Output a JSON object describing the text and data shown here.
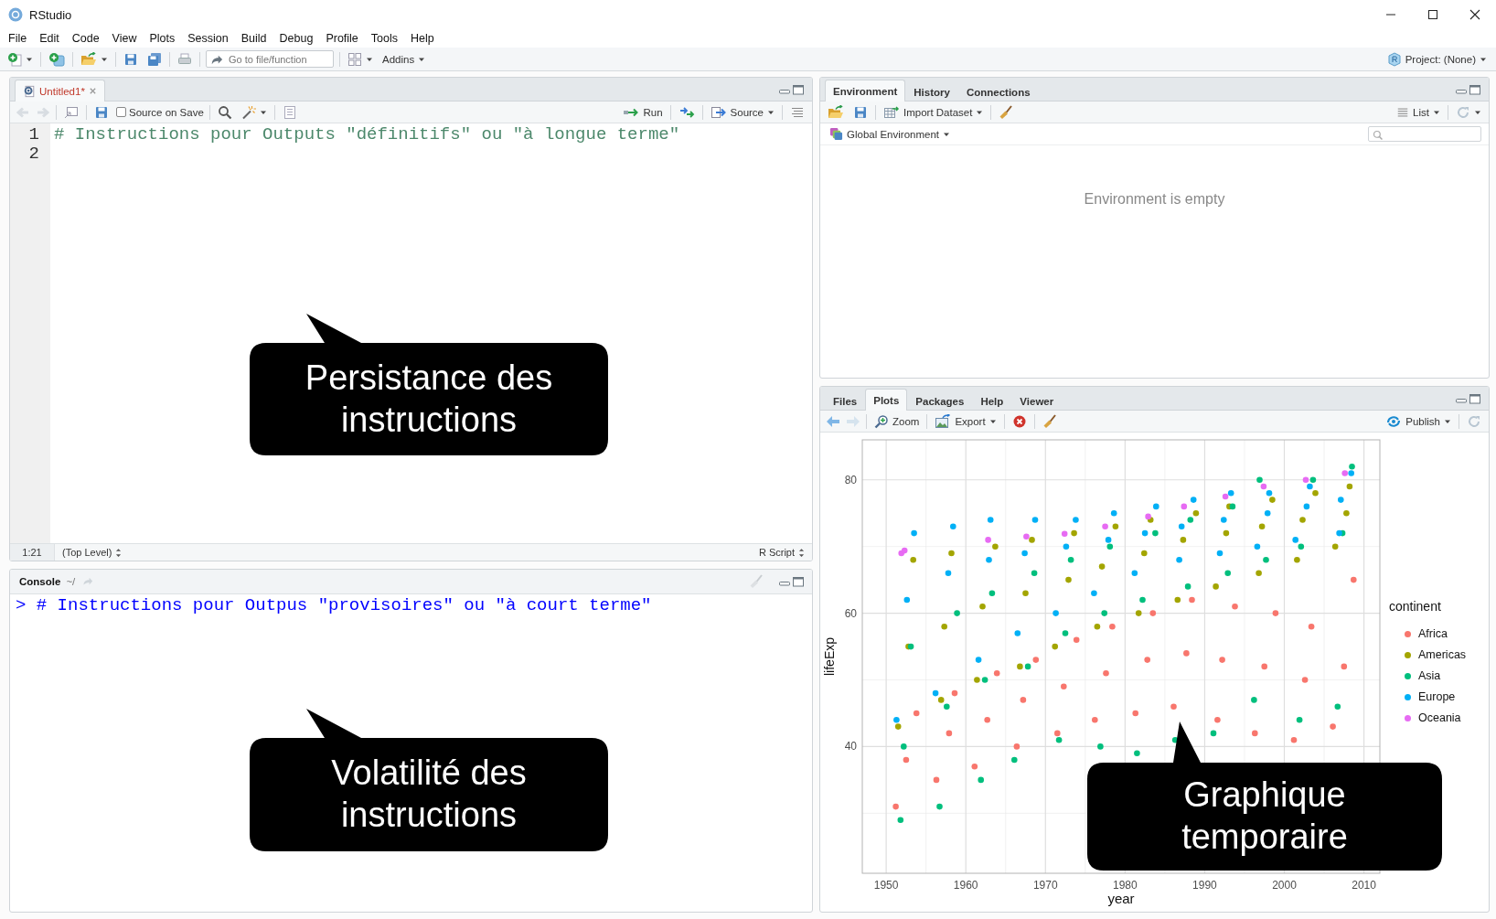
{
  "window": {
    "title": "RStudio"
  },
  "menu": [
    "File",
    "Edit",
    "Code",
    "View",
    "Plots",
    "Session",
    "Build",
    "Debug",
    "Profile",
    "Tools",
    "Help"
  ],
  "toolbar": {
    "goto_placeholder": "Go to file/function",
    "addins": "Addins",
    "project": "Project: (None)"
  },
  "editor": {
    "tabs": [
      {
        "label": "Untitled1*",
        "selected": true,
        "unsaved": true
      }
    ],
    "source_on_save": {
      "label": "Source on Save",
      "checked": false
    },
    "run": "Run",
    "source": "Source",
    "lines": [
      {
        "number": "1",
        "code": "# Instructions pour Outputs \"définitifs\" ou \"à longue terme\""
      },
      {
        "number": "2"
      }
    ],
    "status": {
      "position": "1:21",
      "scope": "(Top Level)",
      "file_type": "R Script"
    }
  },
  "console": {
    "title": "Console",
    "path": "~/",
    "prompt": ">",
    "command": "# Instructions pour Outpus \"provisoires\" ou \"à court terme\""
  },
  "environment_pane": {
    "tabs": [
      {
        "label": "Environment",
        "selected": true
      },
      {
        "label": "History",
        "selected": false
      },
      {
        "label": "Connections",
        "selected": false
      }
    ],
    "import_dataset": "Import Dataset",
    "view_mode": "List",
    "scope": "Global Environment",
    "empty_message": "Environment is empty"
  },
  "plots_pane": {
    "tabs": [
      {
        "label": "Files",
        "selected": false
      },
      {
        "label": "Plots",
        "selected": true
      },
      {
        "label": "Packages",
        "selected": false
      },
      {
        "label": "Help",
        "selected": false
      },
      {
        "label": "Viewer",
        "selected": false
      }
    ],
    "zoom": "Zoom",
    "export": "Export",
    "publish": "Publish",
    "legend_title": "continent",
    "chart_data": {
      "type": "scatter",
      "xlabel": "year",
      "ylabel": "lifeExp",
      "xlim": [
        1947,
        2012
      ],
      "ylim": [
        21,
        86
      ],
      "grid": true,
      "legend": "right",
      "xticks": [
        1950,
        1960,
        1970,
        1980,
        1990,
        2000,
        2010
      ],
      "yticks": [
        40,
        60,
        80
      ],
      "series": [
        {
          "name": "Africa",
          "color": "#f8766d",
          "x": [
            1951.2,
            1952.5,
            1953.8,
            1956.3,
            1957.9,
            1958.6,
            1961.1,
            1962.7,
            1963.9,
            1966.4,
            1967.2,
            1968.8,
            1971.5,
            1972.3,
            1973.9,
            1976.2,
            1977.6,
            1978.4,
            1981.3,
            1982.8,
            1983.5,
            1986.1,
            1987.7,
            1988.4,
            1991.6,
            1992.2,
            1993.8,
            1996.3,
            1997.5,
            1998.9,
            2001.2,
            2002.6,
            2003.4,
            2006.1,
            2007.5,
            2008.7
          ],
          "values": [
            31,
            38,
            45,
            35,
            42,
            48,
            37,
            44,
            51,
            40,
            47,
            53,
            42,
            49,
            56,
            44,
            51,
            58,
            45,
            53,
            60,
            46,
            54,
            62,
            44,
            53,
            61,
            42,
            52,
            60,
            41,
            50,
            58,
            43,
            52,
            65
          ]
        },
        {
          "name": "Americas",
          "color": "#a3a500",
          "x": [
            1951.5,
            1952.8,
            1953.4,
            1956.9,
            1957.3,
            1958.2,
            1961.4,
            1962.1,
            1963.7,
            1966.8,
            1967.5,
            1968.3,
            1971.2,
            1972.9,
            1973.6,
            1976.5,
            1977.1,
            1978.8,
            1981.7,
            1982.4,
            1983.2,
            1986.6,
            1987.3,
            1988.9,
            1991.4,
            1992.7,
            1993.1,
            1996.8,
            1997.2,
            1998.5,
            2001.6,
            2002.3,
            2003.9,
            2006.4,
            2007.8,
            2008.2
          ],
          "values": [
            43,
            55,
            68,
            47,
            58,
            69,
            50,
            61,
            70,
            52,
            63,
            71,
            55,
            65,
            72,
            58,
            67,
            73,
            60,
            69,
            74,
            62,
            71,
            75,
            64,
            72,
            76,
            66,
            73,
            77,
            68,
            74,
            78,
            70,
            75,
            79
          ]
        },
        {
          "name": "Asia",
          "color": "#00bf7d",
          "x": [
            1951.8,
            1952.2,
            1953.1,
            1956.7,
            1957.6,
            1958.9,
            1961.9,
            1962.4,
            1963.3,
            1966.1,
            1967.8,
            1968.6,
            1971.7,
            1972.5,
            1973.2,
            1976.9,
            1977.4,
            1978.1,
            1981.5,
            1982.2,
            1983.8,
            1986.3,
            1987.9,
            1988.2,
            1991.1,
            1992.9,
            1993.5,
            1996.2,
            1997.7,
            1996.9,
            2001.9,
            2002.1,
            2003.6,
            2006.7,
            2007.3,
            2008.5
          ],
          "values": [
            29,
            40,
            55,
            31,
            46,
            60,
            35,
            50,
            63,
            38,
            52,
            66,
            41,
            57,
            68,
            40,
            60,
            70,
            39,
            62,
            72,
            41,
            64,
            74,
            42,
            66,
            76,
            47,
            68,
            80,
            44,
            70,
            80,
            46,
            72,
            82
          ]
        },
        {
          "name": "Europe",
          "color": "#00b0f6",
          "x": [
            1951.3,
            1952.6,
            1953.5,
            1956.2,
            1957.8,
            1958.4,
            1961.6,
            1962.9,
            1963.1,
            1966.5,
            1967.4,
            1968.7,
            1971.3,
            1972.6,
            1973.8,
            1976.1,
            1977.9,
            1978.6,
            1981.2,
            1982.5,
            1983.9,
            1986.8,
            1987.1,
            1988.6,
            1991.9,
            1992.4,
            1993.3,
            1996.6,
            1997.9,
            1998.1,
            2001.4,
            2002.8,
            2003.2,
            2006.9,
            2007.1,
            2008.4
          ],
          "values": [
            44,
            62,
            72,
            48,
            66,
            73,
            53,
            68,
            74,
            57,
            69,
            74,
            60,
            70,
            74,
            63,
            71,
            75,
            66,
            72,
            76,
            68,
            73,
            77,
            69,
            74,
            78,
            70,
            75,
            78,
            71,
            76,
            79,
            72,
            77,
            81
          ]
        },
        {
          "name": "Oceania",
          "color": "#e76bf3",
          "x": [
            1951.9,
            1952.3,
            1962.8,
            1967.6,
            1972.4,
            1977.5,
            1982.9,
            1987.4,
            1992.6,
            1997.4,
            2002.7,
            2007.6
          ],
          "values": [
            69,
            69.4,
            71,
            71.5,
            71.9,
            73,
            74.5,
            76,
            77.5,
            79,
            80,
            81
          ]
        }
      ]
    }
  },
  "callouts": [
    {
      "text": "Persistance des instructions"
    },
    {
      "text": "Volatilité des instructions"
    },
    {
      "text": "Graphique temporaire"
    }
  ]
}
